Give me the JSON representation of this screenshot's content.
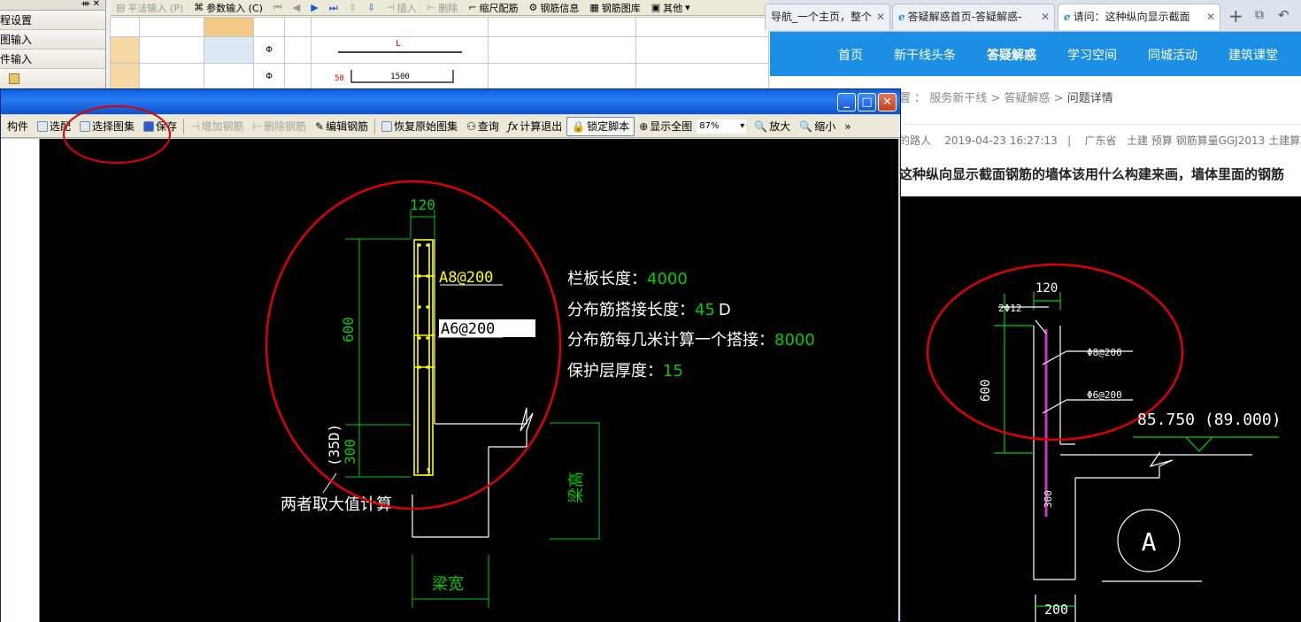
{
  "bg_app": {
    "toolbar": {
      "flat_input": "平法输入 (P)",
      "param_input": "参数输入 (C)",
      "insert": "插入",
      "delete": "删除",
      "scale_rebar": "缩尺配筋",
      "rebar_info": "钢筋信息",
      "rebar_library": "钢筋图库",
      "other": "其他"
    },
    "left_nav": {
      "items": [
        "程设置",
        "图输入",
        "件输入"
      ]
    },
    "grid": {
      "row1_symbol": "Φ",
      "row1_shape_label": "L",
      "row2_symbol": "Φ",
      "row2_hook": "50",
      "row2_length": "1500"
    }
  },
  "dialog": {
    "toolbar": {
      "component": "构件",
      "select_rebar": "选配",
      "select_atlas": "选择图集",
      "save": "保存",
      "add_rebar": "增加钢筋",
      "delete_rebar": "删除钢筋",
      "edit_rebar": "编辑钢筋",
      "restore_atlas": "恢复原始图集",
      "query": "查询",
      "calc_exit": "计算退出",
      "lock_script": "锁定脚本",
      "show_all": "显示全图",
      "zoom_value": "87%",
      "zoom_in": "放大",
      "zoom_out": "缩小",
      "more": "»"
    },
    "drawing": {
      "dim_width": "120",
      "dim_height": "600",
      "dim_anchor": "300",
      "dim_anchor_formula": "(35D)",
      "rebar_vertical": "A8@200",
      "rebar_horizontal": "A6@200",
      "param_board_length_label": "栏板长度：",
      "param_board_length_value": "4000",
      "param_lap_label": "分布筋搭接长度：",
      "param_lap_value": "45",
      "param_lap_unit": "D",
      "param_lap_every_label": "分布筋每几米计算一个搭接：",
      "param_lap_every_value": "8000",
      "param_cover_label": "保护层厚度：",
      "param_cover_value": "15",
      "note_max": "两者取大值计算",
      "beam_height": "梁高",
      "beam_width": "梁宽"
    },
    "colors": {
      "canvas": "#000000",
      "dim_green": "#00cc00",
      "rebar_yellow": "#ffff00",
      "annotation_red": "#e00000"
    }
  },
  "browser": {
    "tabs": [
      {
        "label": "导航_一个主页，整个",
        "active": false
      },
      {
        "label": "答疑解惑首页-答疑解惑-",
        "active": false
      },
      {
        "label": "请问：这种纵向显示截面",
        "active": true
      }
    ],
    "nav": [
      "首页",
      "新干线头条",
      "答疑解惑",
      "学习空间",
      "同城活动",
      "建筑课堂"
    ],
    "breadcrumb": {
      "prefix": "置",
      "sep": ">",
      "items": [
        "服务新干线",
        "答疑解惑"
      ],
      "current": "问题详情"
    },
    "meta": {
      "author": "的路人",
      "date": "2019-04-23 16:27:13",
      "province": "广东省",
      "tags": "土建  预算  钢筋算量GGJ2013  土建算量"
    },
    "question_title": "这种纵向显示截面钢筋的墙体该用什么构建来画，墙体里面的钢筋",
    "drawing": {
      "dim_width": "120",
      "rebar_top": "2Φ12",
      "rebar_a": "Φ8@200",
      "rebar_b": "Φ6@200",
      "dim_height": "600",
      "elevation": "85.750 (89.000)",
      "dim_anchor": "300",
      "axis_label": "A",
      "dim_bottom": "200"
    }
  }
}
